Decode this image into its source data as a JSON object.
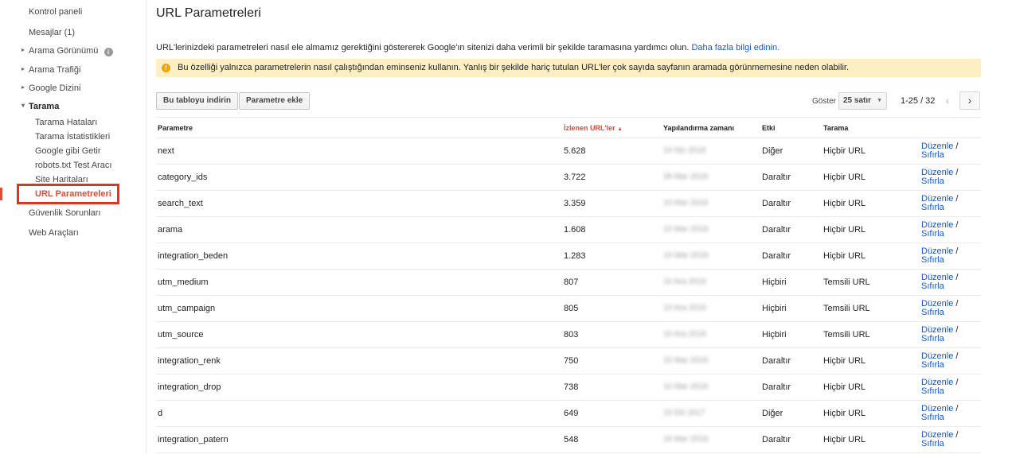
{
  "sidebar": {
    "items": [
      {
        "label": "Kontrol paneli",
        "arrow": ""
      },
      {
        "label": "Mesajlar (1)",
        "arrow": ""
      },
      {
        "label": "Arama Görünümü",
        "arrow": "▸",
        "info": "i"
      },
      {
        "label": "Arama Trafiği",
        "arrow": "▸"
      },
      {
        "label": "Google Dizini",
        "arrow": "▸"
      },
      {
        "label": "Tarama",
        "arrow": "▾"
      }
    ],
    "subitems": [
      "Tarama Hataları",
      "Tarama İstatistikleri",
      "Google gibi Getir",
      "robots.txt Test Aracı",
      "Site Haritaları",
      "URL Parametreleri"
    ],
    "bottom_items": [
      "Güvenlik Sorunları",
      "Web Araçları"
    ]
  },
  "page": {
    "title": "URL Parametreleri",
    "description": "URL'lerinizdeki parametreleri nasıl ele almamız gerektiğini göstererek Google'ın sitenizi daha verimli bir şekilde taramasına yardımcı olun.",
    "learn_more": "Daha fazla bilgi edinin.",
    "warning_icon": "!",
    "warning": "Bu özelliği yalnızca parametrelerin nasıl çalıştığından eminseniz kullanın. Yanlış bir şekilde hariç tutulan URL'ler çok sayıda sayfanın aramada görünmemesine neden olabilir."
  },
  "toolbar": {
    "download_label": "Bu tabloyu indirin",
    "add_label": "Parametre ekle",
    "show_label": "Göster",
    "rows_value": "25 satır",
    "pager_text": "1-25 / 32",
    "prev": "‹",
    "next": "›"
  },
  "table": {
    "headers": {
      "param": "Parametre",
      "urls": "İzlenen URL'ler",
      "time": "Yapılandırma zamanı",
      "effect": "Etki",
      "crawl": "Tarama"
    },
    "sort_arrow": "▲",
    "edit_label": "Düzenle",
    "reset_label": "Sıfırla",
    "rows": [
      {
        "param": "next",
        "urls": "5.628",
        "time": "24 Nis 2018",
        "effect": "Diğer",
        "crawl": "Hiçbir URL"
      },
      {
        "param": "category_ids",
        "urls": "3.722",
        "time": "28 Mar 2018",
        "effect": "Daraltır",
        "crawl": "Hiçbir URL"
      },
      {
        "param": "search_text",
        "urls": "3.359",
        "time": "10 Mar 2018",
        "effect": "Daraltır",
        "crawl": "Hiçbir URL"
      },
      {
        "param": "arama",
        "urls": "1.608",
        "time": "10 Mar 2018",
        "effect": "Daraltır",
        "crawl": "Hiçbir URL"
      },
      {
        "param": "integration_beden",
        "urls": "1.283",
        "time": "10 Mar 2018",
        "effect": "Daraltır",
        "crawl": "Hiçbir URL"
      },
      {
        "param": "utm_medium",
        "urls": "807",
        "time": "10 Ara 2016",
        "effect": "Hiçbiri",
        "crawl": "Temsili URL"
      },
      {
        "param": "utm_campaign",
        "urls": "805",
        "time": "10 Ara 2016",
        "effect": "Hiçbiri",
        "crawl": "Temsili URL"
      },
      {
        "param": "utm_source",
        "urls": "803",
        "time": "10 Ara 2016",
        "effect": "Hiçbiri",
        "crawl": "Temsili URL"
      },
      {
        "param": "integration_renk",
        "urls": "750",
        "time": "10 Mar 2018",
        "effect": "Daraltır",
        "crawl": "Hiçbir URL"
      },
      {
        "param": "integration_drop",
        "urls": "738",
        "time": "10 Mar 2018",
        "effect": "Daraltır",
        "crawl": "Hiçbir URL"
      },
      {
        "param": "d",
        "urls": "649",
        "time": "15 Eki 2017",
        "effect": "Diğer",
        "crawl": "Hiçbir URL"
      },
      {
        "param": "integration_patern",
        "urls": "548",
        "time": "16 Mar 2018",
        "effect": "Daraltır",
        "crawl": "Hiçbir URL"
      }
    ]
  },
  "colors": {
    "link": "#1155cc",
    "accent_red": "#dd4b39",
    "warning_bg": "#fcefc4",
    "warning_icon": "#f0a30a"
  }
}
